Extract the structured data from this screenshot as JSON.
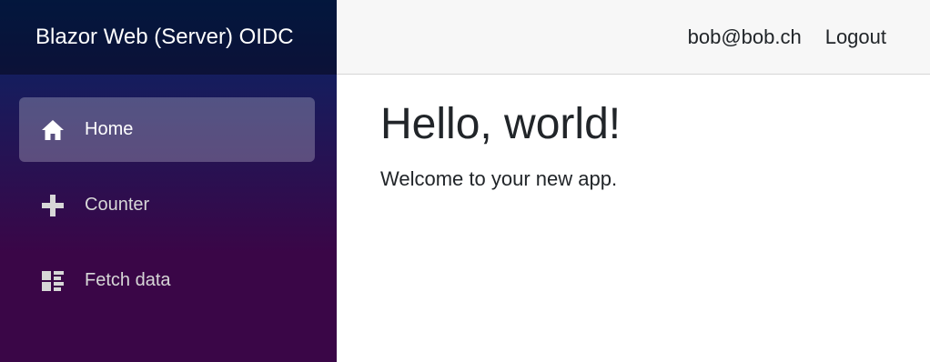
{
  "brand": {
    "title": "Blazor Web (Server) OIDC"
  },
  "nav": {
    "items": [
      {
        "label": "Home",
        "icon": "home-icon",
        "active": true
      },
      {
        "label": "Counter",
        "icon": "plus-icon",
        "active": false
      },
      {
        "label": "Fetch data",
        "icon": "list-rich-icon",
        "active": false
      }
    ]
  },
  "topbar": {
    "user": "bob@bob.ch",
    "logout_label": "Logout"
  },
  "main": {
    "heading": "Hello, world!",
    "text": "Welcome to your new app."
  },
  "colors": {
    "sidebar_top": "#052767",
    "sidebar_bottom": "#3a0647",
    "topbar_bg": "#f7f7f7",
    "text": "#212529"
  }
}
